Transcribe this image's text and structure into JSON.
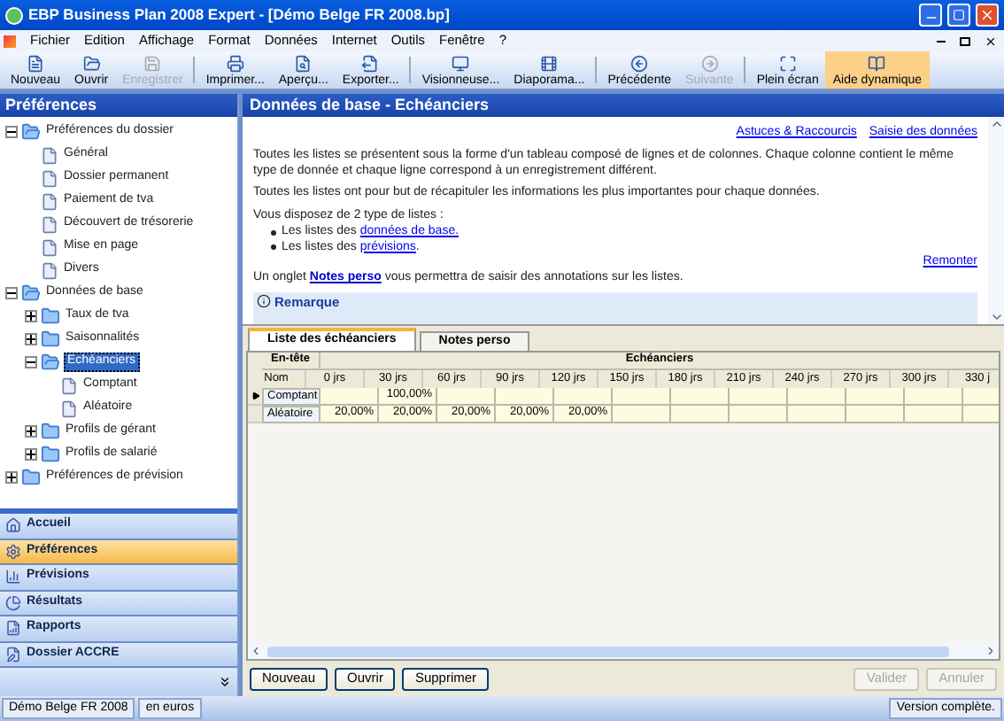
{
  "window": {
    "title": "EBP Business Plan 2008 Expert - [Démo Belge FR 2008.bp]"
  },
  "menu": [
    "Fichier",
    "Edition",
    "Affichage",
    "Format",
    "Données",
    "Internet",
    "Outils",
    "Fenêtre",
    "?"
  ],
  "toolbar": [
    {
      "label": "Nouveau",
      "disabled": false,
      "active": false
    },
    {
      "label": "Ouvrir",
      "disabled": false,
      "active": false
    },
    {
      "label": "Enregistrer",
      "disabled": true,
      "active": false
    },
    {
      "label": "Imprimer...",
      "disabled": false,
      "active": false
    },
    {
      "label": "Aperçu...",
      "disabled": false,
      "active": false
    },
    {
      "label": "Exporter...",
      "disabled": false,
      "active": false
    },
    {
      "label": "Visionneuse...",
      "disabled": false,
      "active": false
    },
    {
      "label": "Diaporama...",
      "disabled": false,
      "active": false
    },
    {
      "label": "Précédente",
      "disabled": false,
      "active": false
    },
    {
      "label": "Suivante",
      "disabled": true,
      "active": false
    },
    {
      "label": "Plein écran",
      "disabled": false,
      "active": false
    },
    {
      "label": "Aide dynamique",
      "disabled": false,
      "active": true
    }
  ],
  "sidebar": {
    "title": "Préférences",
    "tree": [
      {
        "label": "Préférences du dossier",
        "kind": "folder",
        "expanded": true,
        "selected": false,
        "children": [
          {
            "label": "Général",
            "kind": "doc",
            "selected": false
          },
          {
            "label": "Dossier permanent",
            "kind": "doc",
            "selected": false
          },
          {
            "label": "Paiement de tva",
            "kind": "doc",
            "selected": false
          },
          {
            "label": "Découvert de trésorerie",
            "kind": "doc",
            "selected": false
          },
          {
            "label": "Mise en page",
            "kind": "doc",
            "selected": false
          },
          {
            "label": "Divers",
            "kind": "doc",
            "selected": false
          }
        ]
      },
      {
        "label": "Données de base",
        "kind": "folder",
        "expanded": true,
        "selected": false,
        "children": [
          {
            "label": "Taux de tva",
            "kind": "folder",
            "expanded": false,
            "selected": false
          },
          {
            "label": "Saisonnalités",
            "kind": "folder",
            "expanded": false,
            "selected": false
          },
          {
            "label": "Echéanciers",
            "kind": "folder",
            "expanded": true,
            "selected": true,
            "children": [
              {
                "label": "Comptant",
                "kind": "doc",
                "selected": false
              },
              {
                "label": "Aléatoire",
                "kind": "doc",
                "selected": false
              }
            ]
          },
          {
            "label": "Profils de gérant",
            "kind": "folder",
            "expanded": false,
            "selected": false
          },
          {
            "label": "Profils de salarié",
            "kind": "folder",
            "expanded": false,
            "selected": false
          }
        ]
      },
      {
        "label": "Préférences de prévision",
        "kind": "folder",
        "expanded": false,
        "selected": false
      }
    ],
    "nav": [
      {
        "label": "Accueil",
        "selected": false
      },
      {
        "label": "Préférences",
        "selected": true
      },
      {
        "label": "Prévisions",
        "selected": false
      },
      {
        "label": "Résultats",
        "selected": false
      },
      {
        "label": "Rapports",
        "selected": false
      },
      {
        "label": "Dossier ACCRE",
        "selected": false
      }
    ]
  },
  "content": {
    "title": "Données de base - Echéanciers",
    "links": [
      "Astuces & Raccourcis",
      "Saisie des données"
    ],
    "paragraphs": [
      "Toutes les listes se présentent sous la forme d'un tableau composé de lignes et de colonnes. Chaque colonne contient le même type de donnée et chaque ligne correspond à un enregistrement différent.",
      "Toutes les listes ont pour but de récapituler les informations les plus importantes pour chaque données."
    ],
    "list_intro": "Vous disposez de 2 type de listes :",
    "bullets": [
      {
        "text": "Les listes des",
        "link": "données de base."
      },
      {
        "text": "Les listes des",
        "link": "prévisions",
        "after": "."
      }
    ],
    "back_link": "Remonter",
    "note": {
      "before": "Un onglet",
      "link": "Notes perso",
      "after": "vous permettra de saisir des annotations sur les listes."
    },
    "remark": "Remarque",
    "tabs": [
      {
        "label": "Liste des échéanciers",
        "selected": true
      },
      {
        "label": "Notes perso",
        "selected": false
      }
    ],
    "grid": {
      "group_header": "En-tête",
      "group": "Echéanciers",
      "columns": [
        "Nom",
        "0 jrs",
        "30 jrs",
        "60 jrs",
        "90 jrs",
        "120 jrs",
        "150 jrs",
        "180 jrs",
        "210 jrs",
        "240 jrs",
        "270 jrs",
        "300 jrs",
        "330 j"
      ],
      "rows": [
        {
          "selected": true,
          "cells": [
            "Comptant",
            "",
            "100,00%",
            "",
            "",
            "",
            "",
            "",
            "",
            "",
            "",
            "",
            ""
          ]
        },
        {
          "selected": false,
          "cells": [
            "Aléatoire",
            "20,00%",
            "20,00%",
            "20,00%",
            "20,00%",
            "20,00%",
            "",
            "",
            "",
            "",
            "",
            "",
            ""
          ]
        }
      ]
    },
    "buttons": [
      {
        "label": "Nouveau",
        "disabled": false
      },
      {
        "label": "Ouvrir",
        "disabled": false
      },
      {
        "label": "Supprimer",
        "disabled": false
      }
    ],
    "right_buttons": [
      {
        "label": "Valider",
        "disabled": true
      },
      {
        "label": "Annuler",
        "disabled": true
      }
    ]
  },
  "status_bar": [
    "Démo Belge FR 2008",
    "en euros",
    "Version complète."
  ]
}
